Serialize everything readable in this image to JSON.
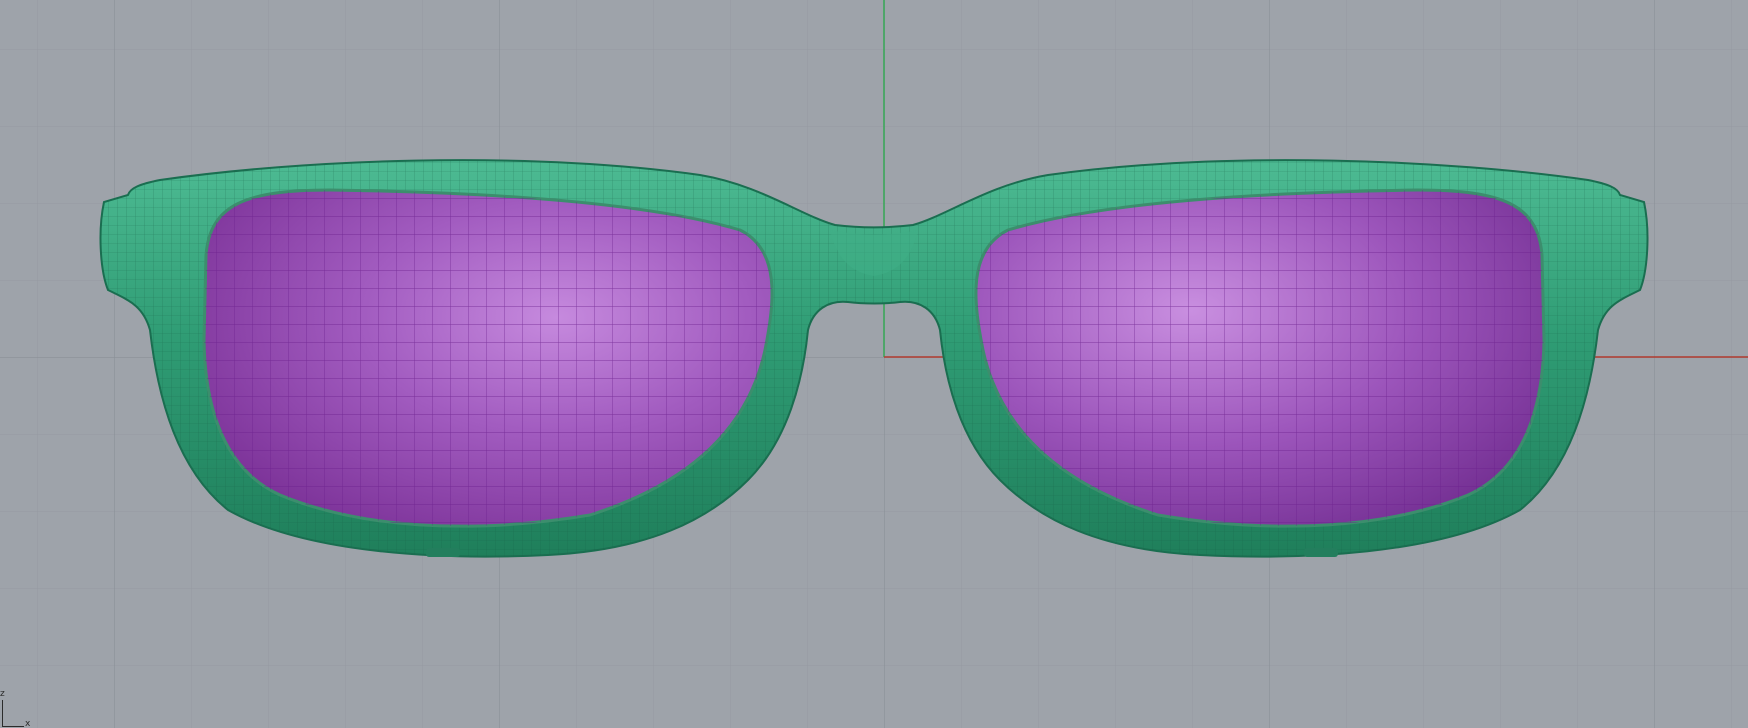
{
  "viewport": {
    "view": "front",
    "background_color": "#9ea3aa",
    "grid_color": "#8e949b",
    "x_axis_color": "#b03a2e",
    "y_axis_color": "#2fa84f",
    "grid": true
  },
  "model": {
    "object": "eyeglasses",
    "frame_color": "#2d9a72",
    "frame_wire_color": "#155c43",
    "lens_color": "#9f58b8",
    "lens_wire_color": "#6a1f8c",
    "display_mode": "shaded-wireframe"
  },
  "axis_triad": {
    "z_label": "z",
    "x_label": "x"
  }
}
